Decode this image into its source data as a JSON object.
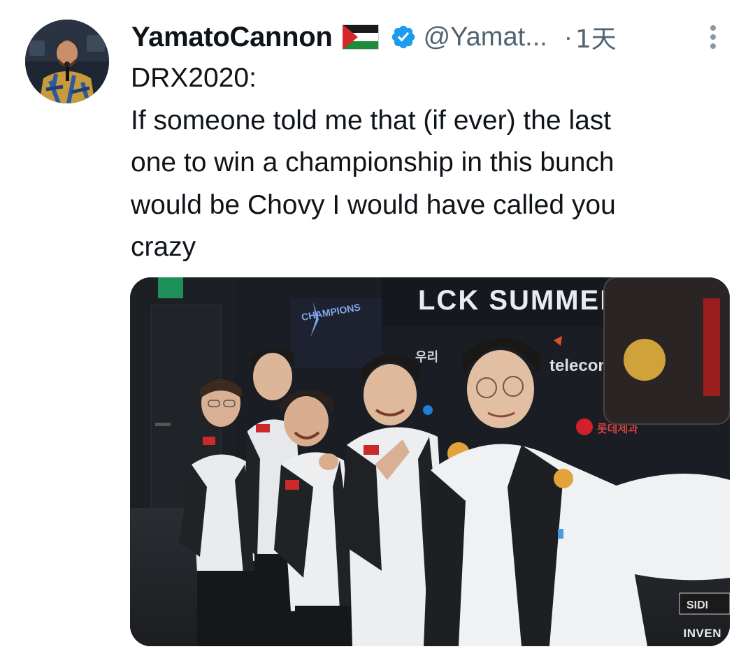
{
  "tweet": {
    "author": {
      "display_name": "YamatoCannon",
      "flag_icon": "palestine-flag-icon",
      "verified_icon": "verified-badge-icon",
      "verified_color": "#1d9bf0",
      "handle": "@Yamat..."
    },
    "separator": "·",
    "timestamp": "1天",
    "more_icon": "more-vertical-icon",
    "text_lines": [
      "DRX2020:",
      "If someone told me that (if ever) the last",
      "one to win a championship in this bunch",
      "would be Chovy I would have called you",
      "crazy"
    ],
    "media": {
      "banner_text": "LCK SUMMER",
      "logo_text": "CHAMPIONS",
      "sponsor_text": "telecom",
      "watermark": "INVEN"
    }
  },
  "colors": {
    "text_primary": "#0f1419",
    "text_secondary": "#536471",
    "accent": "#1d9bf0"
  }
}
